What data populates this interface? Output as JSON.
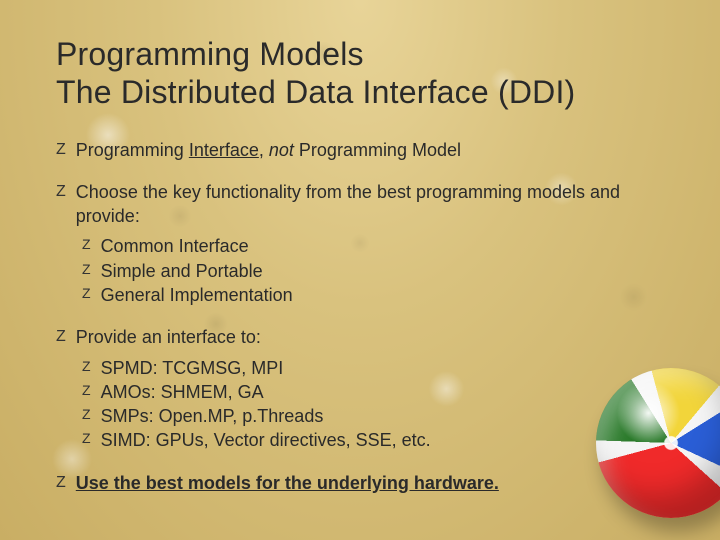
{
  "title_line1": "Programming Models",
  "title_line2": "The Distributed Data Interface (DDI)",
  "bullets": [
    {
      "segments": [
        {
          "t": "Programming "
        },
        {
          "t": "Interface",
          "u": true
        },
        {
          "t": ", "
        },
        {
          "t": "not",
          "i": true
        },
        {
          "t": " Programming Model"
        }
      ]
    },
    {
      "segments": [
        {
          "t": "Choose the key functionality from the best programming models and provide:"
        }
      ],
      "children": [
        {
          "segments": [
            {
              "t": "Common Interface"
            }
          ]
        },
        {
          "segments": [
            {
              "t": "Simple and Portable"
            }
          ]
        },
        {
          "segments": [
            {
              "t": "General Implementation"
            }
          ]
        }
      ]
    },
    {
      "segments": [
        {
          "t": "Provide an interface to:"
        }
      ],
      "children": [
        {
          "segments": [
            {
              "t": "SPMD: TCGMSG, MPI"
            }
          ]
        },
        {
          "segments": [
            {
              "t": "AMOs: SHMEM, GA"
            }
          ]
        },
        {
          "segments": [
            {
              "t": "SMPs: Open.MP, p.Threads"
            }
          ]
        },
        {
          "segments": [
            {
              "t": "SIMD: GPUs, Vector directives, SSE, etc."
            }
          ]
        }
      ]
    },
    {
      "segments": [
        {
          "t": "Use the best  models for the underlying hardware.",
          "b": true,
          "u": true
        }
      ]
    }
  ],
  "bullet_glyph": "Z"
}
